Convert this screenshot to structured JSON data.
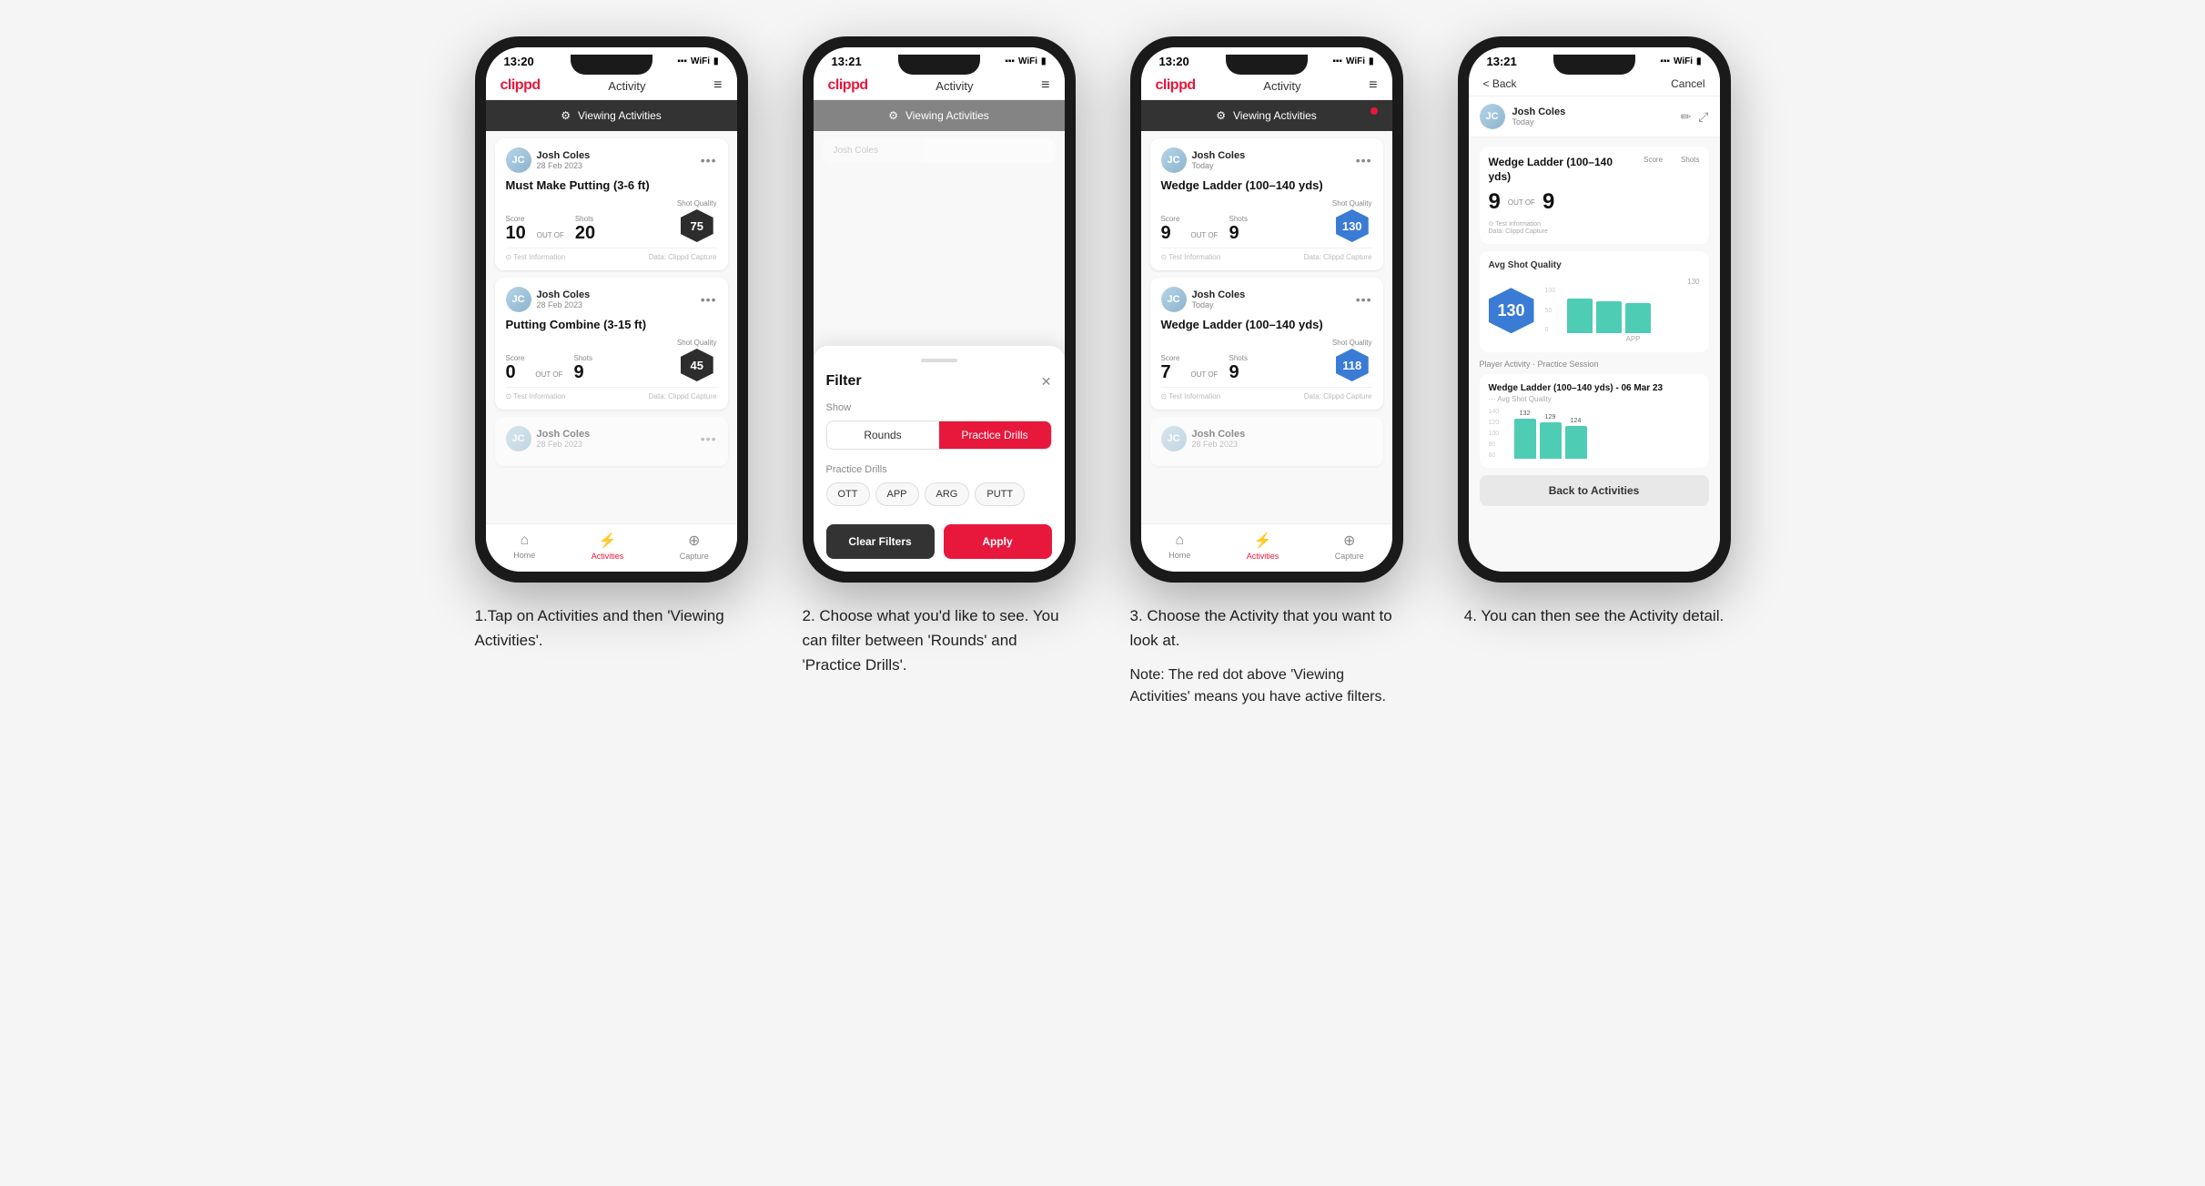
{
  "phones": [
    {
      "id": "phone1",
      "status_time": "13:20",
      "header_logo": "clippd",
      "header_title": "Activity",
      "banner_text": "Viewing Activities",
      "show_red_dot": false,
      "activities": [
        {
          "user_name": "Josh Coles",
          "user_date": "28 Feb 2023",
          "title": "Must Make Putting (3-6 ft)",
          "score_label": "Score",
          "shots_label": "Shots",
          "shot_quality_label": "Shot Quality",
          "score": "10",
          "outof": "OUT OF",
          "shots": "20",
          "shot_quality": "75",
          "info_left": "Test Information",
          "info_right": "Data: Clippd Capture"
        },
        {
          "user_name": "Josh Coles",
          "user_date": "28 Feb 2023",
          "title": "Putting Combine (3-15 ft)",
          "score_label": "Score",
          "shots_label": "Shots",
          "shot_quality_label": "Shot Quality",
          "score": "0",
          "outof": "OUT OF",
          "shots": "9",
          "shot_quality": "45",
          "info_left": "Test Information",
          "info_right": "Data: Clippd Capture"
        }
      ],
      "nav": [
        "Home",
        "Activities",
        "Capture"
      ],
      "nav_active": 1
    },
    {
      "id": "phone2",
      "status_time": "13:21",
      "header_logo": "clippd",
      "header_title": "Activity",
      "banner_text": "Viewing Activities",
      "show_red_dot": false,
      "filter_title": "Filter",
      "show_label": "Show",
      "filter_tabs": [
        "Rounds",
        "Practice Drills"
      ],
      "filter_active_tab": 1,
      "practice_drills_label": "Practice Drills",
      "drill_pills": [
        "OTT",
        "APP",
        "ARG",
        "PUTT"
      ],
      "btn_clear": "Clear Filters",
      "btn_apply": "Apply",
      "partial_user": "Josh Coles"
    },
    {
      "id": "phone3",
      "status_time": "13:20",
      "header_logo": "clippd",
      "header_title": "Activity",
      "banner_text": "Viewing Activities",
      "show_red_dot": true,
      "activities": [
        {
          "user_name": "Josh Coles",
          "user_date": "Today",
          "title": "Wedge Ladder (100–140 yds)",
          "score_label": "Score",
          "shots_label": "Shots",
          "shot_quality_label": "Shot Quality",
          "score": "9",
          "outof": "OUT OF",
          "shots": "9",
          "shot_quality": "130",
          "badge_color": "blue",
          "info_left": "Test Information",
          "info_right": "Data: Clippd Capture"
        },
        {
          "user_name": "Josh Coles",
          "user_date": "Today",
          "title": "Wedge Ladder (100–140 yds)",
          "score_label": "Score",
          "shots_label": "Shots",
          "shot_quality_label": "Shot Quality",
          "score": "7",
          "outof": "OUT OF",
          "shots": "9",
          "shot_quality": "118",
          "badge_color": "blue",
          "info_left": "Test Information",
          "info_right": "Data: Clippd Capture"
        },
        {
          "user_name": "Josh Coles",
          "user_date": "28 Feb 2023",
          "partial": true
        }
      ],
      "nav": [
        "Home",
        "Activities",
        "Capture"
      ],
      "nav_active": 1
    },
    {
      "id": "phone4",
      "status_time": "13:21",
      "back_label": "< Back",
      "cancel_label": "Cancel",
      "user_name": "Josh Coles",
      "user_date": "Today",
      "detail_title": "Wedge Ladder (100–140 yds)",
      "score_col": "Score",
      "shots_col": "Shots",
      "score_val": "9",
      "outof": "OUT OF",
      "shots_val": "9",
      "info1": "Test Information",
      "info2": "Data: Clippd Capture",
      "avg_quality_label": "Avg Shot Quality",
      "chart_val": "130",
      "chart_bars": [
        132,
        129,
        124
      ],
      "chart_ticks": [
        "140",
        "100",
        "50",
        "0"
      ],
      "chart_x_label": "APP",
      "avg_label": "130",
      "session_label": "Player Activity · Practice Session",
      "drill_detail_title": "Wedge Ladder (100–140 yds) - 06 Mar 23",
      "drill_detail_subtitle": "··· Avg Shot Quality",
      "back_to_activities": "Back to Activities"
    }
  ],
  "captions": [
    "1.Tap on Activities and then 'Viewing Activities'.",
    "2. Choose what you'd like to see. You can filter between 'Rounds' and 'Practice Drills'.",
    "3. Choose the Activity that you want to look at.\n\nNote: The red dot above 'Viewing Activities' means you have active filters.",
    "4. You can then see the Activity detail."
  ]
}
